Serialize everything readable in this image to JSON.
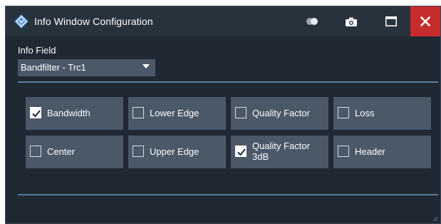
{
  "window": {
    "title": "Info Window Configuration",
    "logo_icon": "rohde-schwarz-diamond-icon",
    "controls": [
      {
        "name": "toggle-icon"
      },
      {
        "name": "camera-icon"
      },
      {
        "name": "maximize-icon"
      },
      {
        "name": "close-icon"
      }
    ]
  },
  "info_field": {
    "label": "Info Field",
    "selected": "Bandfilter - Trc1"
  },
  "checkboxes": [
    {
      "label": "Bandwidth",
      "checked": true
    },
    {
      "label": "Lower Edge",
      "checked": false
    },
    {
      "label": "Quality Factor",
      "checked": false
    },
    {
      "label": "Loss",
      "checked": false
    },
    {
      "label": "Center",
      "checked": false
    },
    {
      "label": "Upper Edge",
      "checked": false
    },
    {
      "label": "Quality Factor 3dB",
      "checked": true
    },
    {
      "label": "Header",
      "checked": false
    }
  ],
  "colors": {
    "window_bg": "#1f2833",
    "titlebar_bg": "#28323d",
    "tile_bg": "#4a5868",
    "divider": "#5b7c99",
    "close_bg": "#c72c2c",
    "logo": "#4a90d9"
  }
}
